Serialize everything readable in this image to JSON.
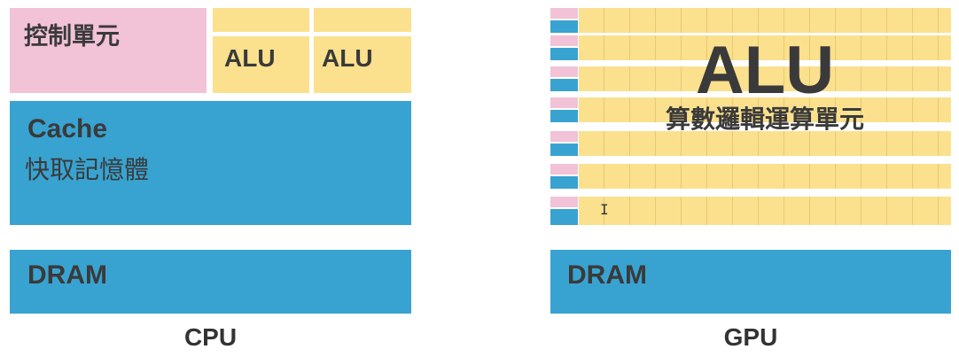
{
  "cpu": {
    "control_label": "控制單元",
    "alu_labels": [
      "ALU",
      "ALU"
    ],
    "cache_label_en": "Cache",
    "cache_label_zh": "快取記憶體",
    "dram_label": "DRAM",
    "caption": "CPU"
  },
  "gpu": {
    "alu_title": "ALU",
    "alu_subtitle": "算數邏輯運算單元",
    "dram_label": "DRAM",
    "caption": "GPU",
    "row_count": 7
  },
  "colors": {
    "control": "#f2c2d6",
    "alu": "#fbe08e",
    "cache": "#38a3d1",
    "dram": "#38a3d1"
  },
  "cursor_glyph": "I"
}
